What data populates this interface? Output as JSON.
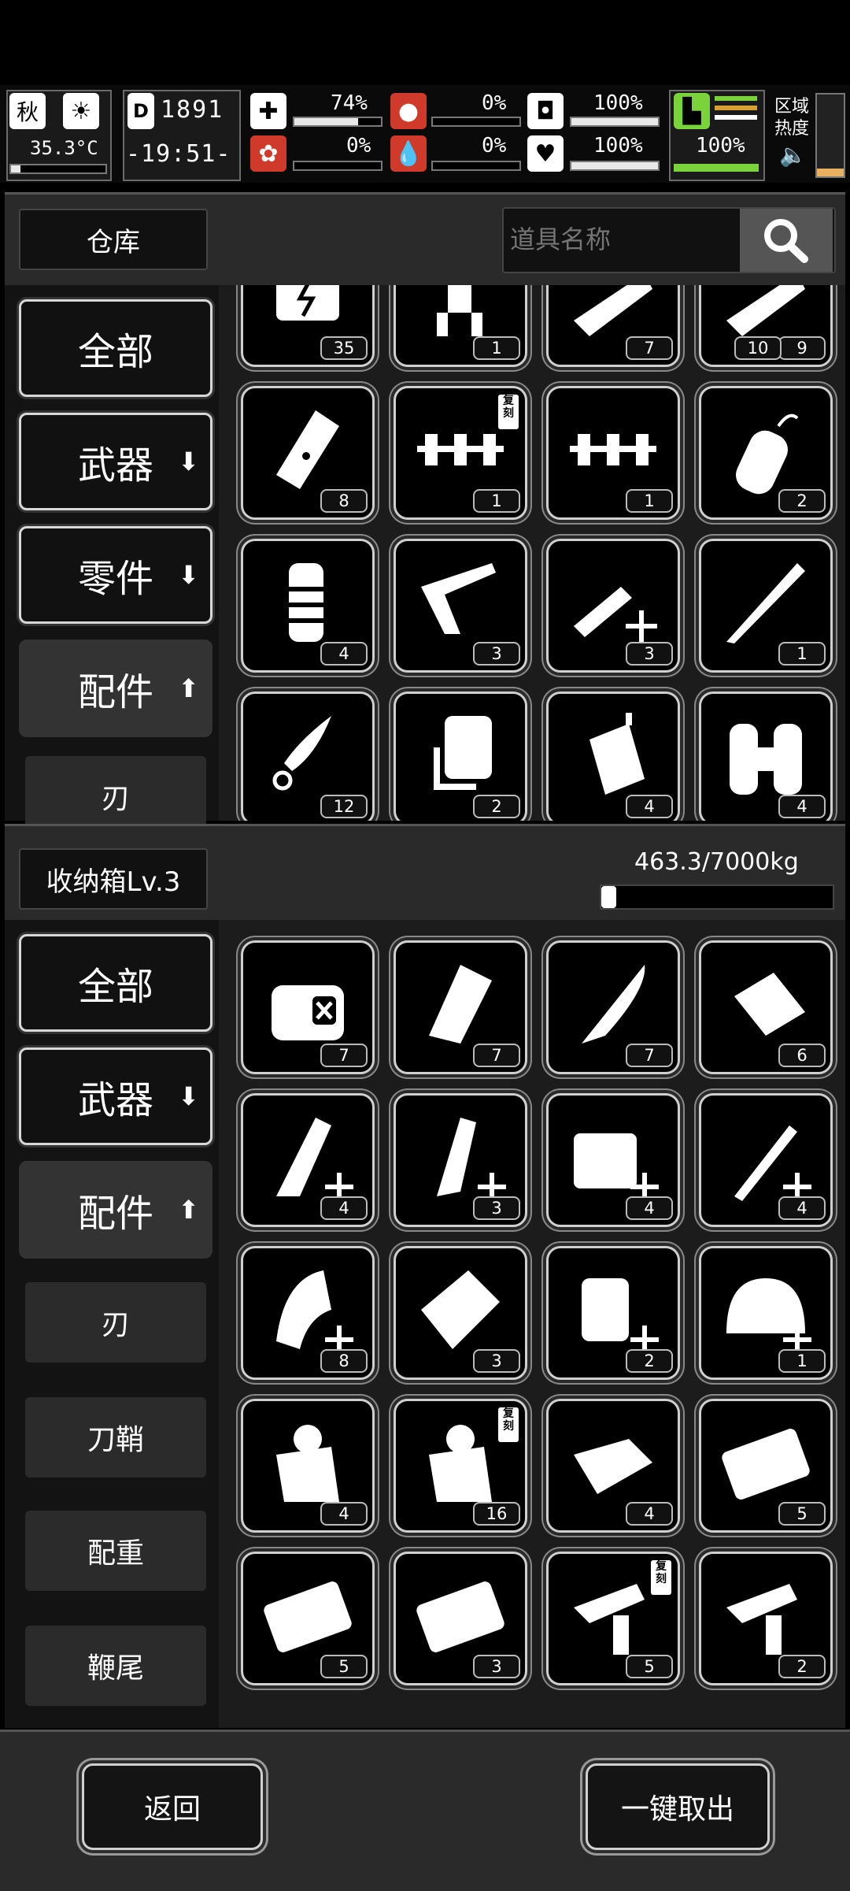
{
  "hud": {
    "season": "秋",
    "temperature": "35.3°C",
    "day": "1891",
    "time": "-19:51-",
    "stats": [
      {
        "name": "health",
        "value": "74%",
        "level": 0.74
      },
      {
        "name": "hunger",
        "value": "0%",
        "level": 0.0
      },
      {
        "name": "stamina",
        "value": "100%",
        "level": 1.0
      },
      {
        "name": "sanity",
        "value": "0%",
        "level": 0.0
      },
      {
        "name": "thirst",
        "value": "0%",
        "level": 0.0
      },
      {
        "name": "mood",
        "value": "100%",
        "level": 1.0
      }
    ],
    "leg_value": "100%",
    "zone_heat_label": "区域\n热度",
    "zone_heat_line1": "区域",
    "zone_heat_line2": "热度"
  },
  "warehouse": {
    "title": "仓库",
    "search_placeholder": "道具名称",
    "categories": [
      {
        "label": "全部",
        "arrow": ""
      },
      {
        "label": "武器",
        "arrow": "⬇"
      },
      {
        "label": "零件",
        "arrow": "⬇"
      },
      {
        "label": "配件",
        "arrow": "⬆"
      }
    ],
    "subcategories": [
      "刃"
    ],
    "items": [
      {
        "icon": "battery-pack-icon",
        "count": "35"
      },
      {
        "icon": "cartridge-icon",
        "count": "1"
      },
      {
        "icon": "blade-part-icon",
        "count": "7"
      },
      {
        "icon": "blade-part-icon",
        "count": "9",
        "count2": "10"
      },
      {
        "icon": "light-tube-icon",
        "count": "8"
      },
      {
        "icon": "bullet-belt-icon",
        "count": "1",
        "tag": "复刻"
      },
      {
        "icon": "bullet-belt-icon",
        "count": "1"
      },
      {
        "icon": "gas-canister-icon",
        "count": "2"
      },
      {
        "icon": "grip-icon",
        "count": "4"
      },
      {
        "icon": "stock-icon",
        "count": "3"
      },
      {
        "icon": "blade-upgrade-icon",
        "count": "3"
      },
      {
        "icon": "long-blade-icon",
        "count": "1"
      },
      {
        "icon": "spear-tip-icon",
        "count": "12"
      },
      {
        "icon": "holster-icon",
        "count": "2"
      },
      {
        "icon": "canister-icon",
        "count": "4"
      },
      {
        "icon": "tanks-icon",
        "count": "4"
      }
    ]
  },
  "storage": {
    "title": "收纳箱Lv.3",
    "capacity": "463.3/7000kg",
    "capacity_fraction": 0.066,
    "categories": [
      {
        "label": "全部",
        "arrow": ""
      },
      {
        "label": "武器",
        "arrow": "⬇"
      },
      {
        "label": "配件",
        "arrow": "⬆"
      }
    ],
    "subcategories": [
      "刃",
      "刀鞘",
      "配重",
      "鞭尾"
    ],
    "items": [
      {
        "icon": "pouch-icon",
        "count": "7"
      },
      {
        "icon": "magazine-icon",
        "count": "7"
      },
      {
        "icon": "knife-icon",
        "count": "7"
      },
      {
        "icon": "box-icon",
        "count": "6"
      },
      {
        "icon": "grip-upgrade-icon",
        "count": "4"
      },
      {
        "icon": "pistol-mag-upgrade-icon",
        "count": "3"
      },
      {
        "icon": "case-upgrade-icon",
        "count": "4"
      },
      {
        "icon": "rod-upgrade-icon",
        "count": "4"
      },
      {
        "icon": "drum-mag-upgrade-icon",
        "count": "8"
      },
      {
        "icon": "plates-icon",
        "count": "3"
      },
      {
        "icon": "holster-upgrade-icon",
        "count": "2"
      },
      {
        "icon": "helmet-upgrade-icon",
        "count": "1"
      },
      {
        "icon": "bag-icon",
        "count": "4"
      },
      {
        "icon": "bag-icon",
        "count": "16",
        "tag": "复刻"
      },
      {
        "icon": "toolbox-icon",
        "count": "4"
      },
      {
        "icon": "card-icon",
        "count": "5"
      },
      {
        "icon": "card-icon",
        "count": "5"
      },
      {
        "icon": "card-icon",
        "count": "3"
      },
      {
        "icon": "gun-part-icon",
        "count": "5",
        "tag": "复刻"
      },
      {
        "icon": "gun-part-icon",
        "count": "2"
      }
    ]
  },
  "footer": {
    "back_label": "返回",
    "take_all_label": "一键取出"
  },
  "colors": {
    "accent_green": "#7ad33b",
    "accent_red": "#d03a2a",
    "panel": "#2a2a2a"
  }
}
